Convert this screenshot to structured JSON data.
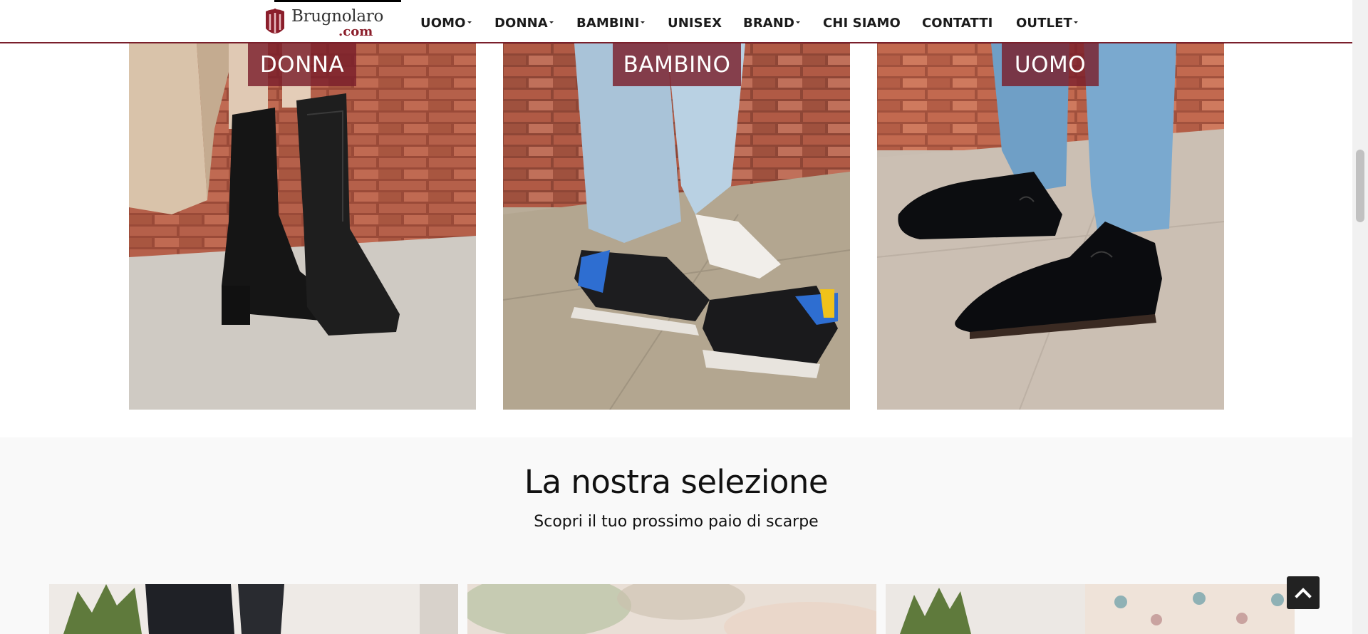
{
  "header": {
    "logo": {
      "name": "Brugnolaro",
      "suffix": ".com"
    },
    "nav": [
      {
        "label": "UOMO",
        "dropdown": true
      },
      {
        "label": "DONNA",
        "dropdown": true
      },
      {
        "label": "BAMBINI",
        "dropdown": true
      },
      {
        "label": "UNISEX",
        "dropdown": false
      },
      {
        "label": "BRAND",
        "dropdown": true
      },
      {
        "label": "CHI SIAMO",
        "dropdown": false
      },
      {
        "label": "CONTATTI",
        "dropdown": false
      },
      {
        "label": "OUTLET",
        "dropdown": true
      }
    ]
  },
  "categories": [
    {
      "label": "DONNA",
      "image": "woman-cowboy-boots-photo"
    },
    {
      "label": "BAMBINO",
      "image": "child-sneakers-photo"
    },
    {
      "label": "UOMO",
      "image": "man-derby-shoes-photo"
    }
  ],
  "selection": {
    "title": "La nostra selezione",
    "subtitle": "Scopri il tuo prossimo paio di scarpe"
  },
  "icons": {
    "back_to_top": "chevron-up-icon"
  },
  "colors": {
    "brand": "#7a1f2b",
    "label_bg": "#7a1f2b",
    "section_bg": "#f9f9f9"
  }
}
